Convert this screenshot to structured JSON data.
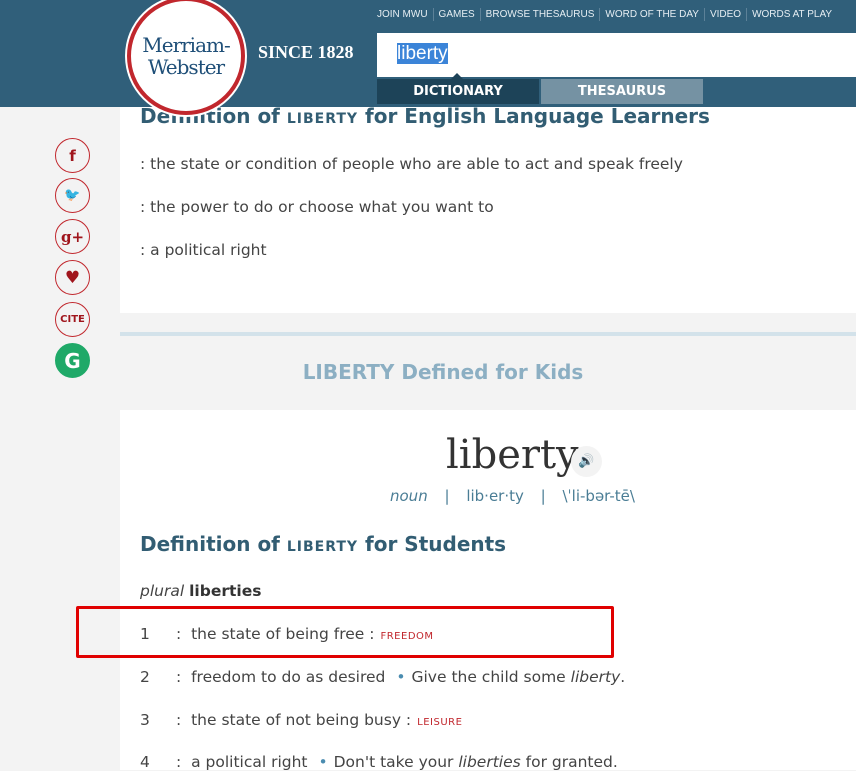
{
  "header": {
    "logo_text": [
      "Merriam-",
      "Webster"
    ],
    "since": "SINCE 1828",
    "nav": [
      "JOIN MWU",
      "GAMES",
      "BROWSE THESAURUS",
      "WORD OF THE DAY",
      "VIDEO",
      "WORDS AT PLAY"
    ],
    "search_value": "liberty",
    "tabs": [
      "DICTIONARY",
      "THESAURUS"
    ]
  },
  "share": {
    "facebook": "f",
    "twitter": "🐦",
    "google_plus": "g+",
    "favorite": "♥",
    "cite": "CITE",
    "grammarly": "G"
  },
  "learners": {
    "heading_pre": "Definition of ",
    "heading_word": "liberty",
    "heading_post": " for English Language Learners",
    "defs": [
      ": the state or condition of people who are able to act and speak freely",
      ": the power to do or choose what you want to",
      ": a political right"
    ]
  },
  "kids": {
    "section_title": "LIBERTY Defined for Kids",
    "headword": "liberty",
    "pos": "noun",
    "syllables": "lib·er·ty",
    "pron": "\\ˈli-bər-tē\\",
    "heading_pre": "Definition of ",
    "heading_word": "liberty",
    "heading_post": " for Students",
    "plural_label": "plural",
    "plural": "liberties",
    "senses": [
      {
        "num": "1",
        "text": "the state of being free :",
        "xref": "FREEDOM"
      },
      {
        "num": "2",
        "text": "freedom to do as desired",
        "ex_pre": "Give the child some ",
        "ex_it": "liberty",
        "ex_post": "."
      },
      {
        "num": "3",
        "text": "the state of not being busy :",
        "xref": "LEISURE"
      },
      {
        "num": "4",
        "text": "a political right",
        "ex_pre": "Don't take your ",
        "ex_it": "liberties",
        "ex_post": " for granted."
      }
    ]
  },
  "colors": {
    "header": "#305f7a",
    "accent": "#c1272d",
    "highlight_box": "#e00000"
  }
}
